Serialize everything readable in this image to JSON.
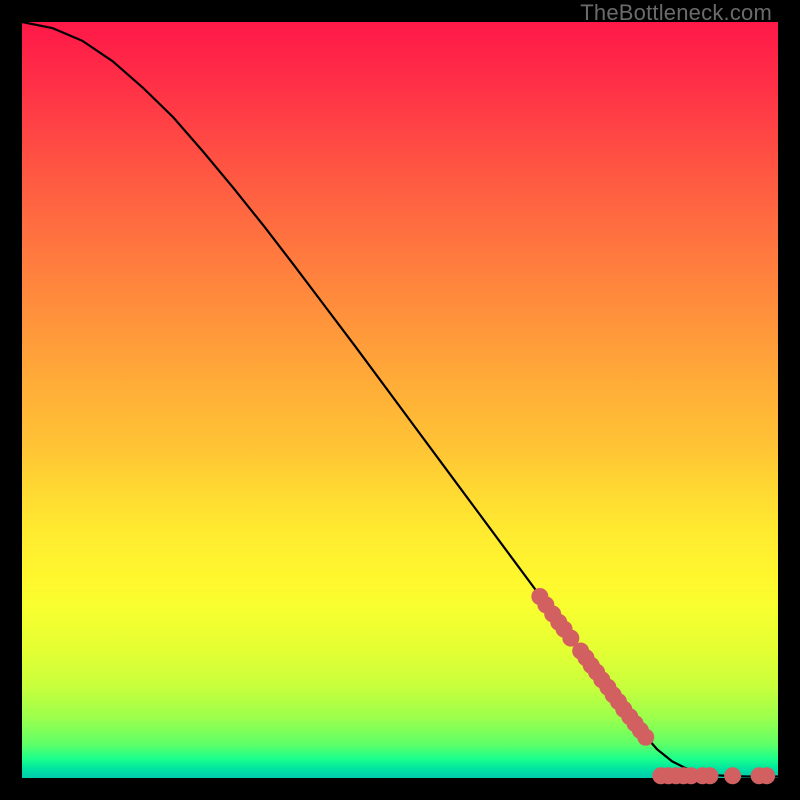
{
  "watermark": "TheBottleneck.com",
  "colors": {
    "dot": "#d36060",
    "curve": "#000000",
    "frame": "#000000"
  },
  "chart_data": {
    "type": "line",
    "title": "",
    "xlabel": "",
    "ylabel": "",
    "xlim": [
      0,
      100
    ],
    "ylim": [
      0,
      100
    ],
    "grid": false,
    "legend": false,
    "series": [
      {
        "name": "curve",
        "x": [
          0,
          4,
          8,
          12,
          16,
          20,
          24,
          28,
          32,
          36,
          40,
          44,
          48,
          52,
          56,
          60,
          64,
          68,
          72,
          76,
          80,
          82,
          84,
          86,
          88,
          90,
          92,
          94,
          96,
          98,
          100
        ],
        "y": [
          100,
          99.2,
          97.5,
          94.8,
          91.3,
          87.4,
          82.8,
          78.0,
          73.0,
          67.8,
          62.5,
          57.2,
          51.8,
          46.4,
          41.0,
          35.6,
          30.2,
          24.8,
          19.4,
          14.0,
          8.6,
          6.1,
          3.8,
          2.2,
          1.2,
          0.6,
          0.35,
          0.25,
          0.2,
          0.2,
          0.2
        ]
      }
    ],
    "points": [
      {
        "name": "marker",
        "x": 68.5,
        "y": 24.0
      },
      {
        "name": "marker",
        "x": 69.3,
        "y": 22.9
      },
      {
        "name": "marker",
        "x": 70.2,
        "y": 21.7
      },
      {
        "name": "marker",
        "x": 71.0,
        "y": 20.6
      },
      {
        "name": "marker",
        "x": 71.7,
        "y": 19.7
      },
      {
        "name": "marker",
        "x": 72.6,
        "y": 18.5
      },
      {
        "name": "marker",
        "x": 73.9,
        "y": 16.8
      },
      {
        "name": "marker",
        "x": 74.6,
        "y": 15.9
      },
      {
        "name": "marker",
        "x": 75.3,
        "y": 14.9
      },
      {
        "name": "marker",
        "x": 76.0,
        "y": 14.0
      },
      {
        "name": "marker",
        "x": 76.7,
        "y": 13.0
      },
      {
        "name": "marker",
        "x": 77.5,
        "y": 12.0
      },
      {
        "name": "marker",
        "x": 78.2,
        "y": 11.0
      },
      {
        "name": "marker",
        "x": 78.9,
        "y": 10.1
      },
      {
        "name": "marker",
        "x": 79.6,
        "y": 9.1
      },
      {
        "name": "marker",
        "x": 80.4,
        "y": 8.1
      },
      {
        "name": "marker",
        "x": 81.1,
        "y": 7.2
      },
      {
        "name": "marker",
        "x": 81.8,
        "y": 6.3
      },
      {
        "name": "marker",
        "x": 82.5,
        "y": 5.4
      },
      {
        "name": "marker",
        "x": 84.5,
        "y": 0.3
      },
      {
        "name": "marker",
        "x": 85.5,
        "y": 0.3
      },
      {
        "name": "marker",
        "x": 86.5,
        "y": 0.3
      },
      {
        "name": "marker",
        "x": 87.5,
        "y": 0.3
      },
      {
        "name": "marker",
        "x": 88.5,
        "y": 0.3
      },
      {
        "name": "marker",
        "x": 90.0,
        "y": 0.3
      },
      {
        "name": "marker",
        "x": 91.0,
        "y": 0.3
      },
      {
        "name": "marker",
        "x": 94.0,
        "y": 0.3
      },
      {
        "name": "marker",
        "x": 97.5,
        "y": 0.3
      },
      {
        "name": "marker",
        "x": 98.5,
        "y": 0.3
      }
    ]
  }
}
